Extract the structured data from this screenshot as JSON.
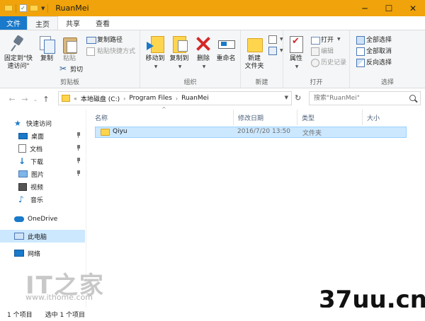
{
  "window": {
    "title": "RuanMei",
    "controls": {
      "minimize": "─",
      "maximize": "☐",
      "close": "✕"
    }
  },
  "ribbon_tabs": [
    {
      "label": "文件"
    },
    {
      "label": "主页"
    },
    {
      "label": "共享"
    },
    {
      "label": "查看"
    }
  ],
  "ribbon": {
    "clipboard": {
      "pin_label": "固定到\"快\n速访问\"",
      "copy_label": "复制",
      "paste_label": "粘贴",
      "copy_path_label": "复制路径",
      "paste_shortcut_label": "粘贴快捷方式",
      "cut_label": "剪切",
      "group_label": "剪贴板"
    },
    "organize": {
      "move_to_label": "移动到",
      "copy_to_label": "复制到",
      "delete_label": "删除",
      "rename_label": "重命名",
      "group_label": "组织"
    },
    "new": {
      "new_folder_label": "新建\n文件夹",
      "group_label": "新建"
    },
    "open": {
      "properties_label": "属性",
      "open_label": "打开",
      "edit_label": "编辑",
      "history_label": "历史记录",
      "group_label": "打开"
    },
    "select": {
      "select_all_label": "全部选择",
      "select_none_label": "全部取消",
      "invert_label": "反向选择",
      "group_label": "选择"
    }
  },
  "nav": {
    "back": "←",
    "forward": "→",
    "recent": "⌄",
    "up": "↑",
    "breadcrumb_prefix": "«",
    "breadcrumbs": [
      "本地磁盘 (C:)",
      "Program Files",
      "RuanMei"
    ],
    "crumb_sep": "›",
    "refresh": "↻",
    "search_placeholder": "搜索\"RuanMei\""
  },
  "sidebar": {
    "items": [
      {
        "label": "快速访问",
        "icon": "star-icon"
      },
      {
        "label": "桌面",
        "icon": "desktop-icon",
        "pinned": true
      },
      {
        "label": "文档",
        "icon": "documents-icon",
        "pinned": true
      },
      {
        "label": "下载",
        "icon": "download-icon",
        "pinned": true
      },
      {
        "label": "图片",
        "icon": "pictures-icon",
        "pinned": true
      },
      {
        "label": "视频",
        "icon": "video-icon"
      },
      {
        "label": "音乐",
        "icon": "music-icon"
      },
      {
        "label": "OneDrive",
        "icon": "cloud-icon"
      },
      {
        "label": "此电脑",
        "icon": "computer-icon",
        "selected": true
      },
      {
        "label": "网络",
        "icon": "network-icon"
      }
    ]
  },
  "file_list": {
    "columns": [
      "名称",
      "修改日期",
      "类型",
      "大小"
    ],
    "sort_indicator": "^",
    "rows": [
      {
        "name": "Qiyu",
        "modified": "2016/7/20 13:50",
        "type": "文件夹",
        "size": ""
      }
    ]
  },
  "status": {
    "item_count": "1 个项目",
    "selected_count": "选中 1 个项目"
  },
  "watermarks": {
    "ithome_logo": "IT之家",
    "ithome_url": "www.ithome.com",
    "site_37uu": "37uu.cn"
  },
  "colors": {
    "titlebar": "#f0a30a",
    "file_tab": "#1979ca",
    "selection": "#cce8ff"
  }
}
